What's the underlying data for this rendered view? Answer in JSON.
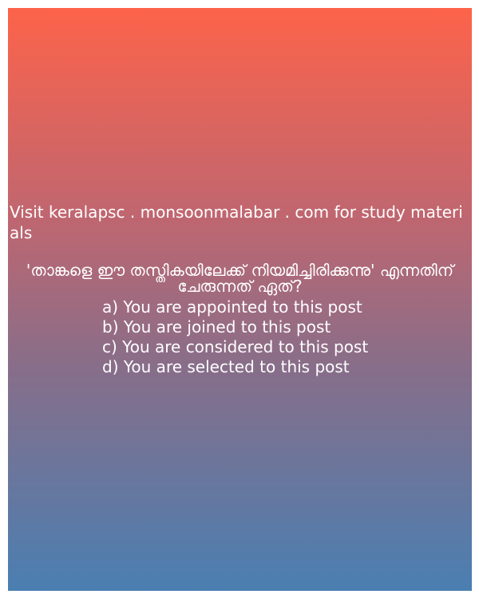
{
  "promo_text": "Visit keralapsc . monsoonmalabar . com for study materials",
  "question": "'താങ്കളെ ഈ തസ്തികയിലേക്ക് നിയമിച്ചിരിക്കുന്നു' എന്നതിന് ചേരുന്നത് ഏത്?",
  "options": [
    "a) You are appointed to this post",
    "b) You are joined to this post",
    "c) You are considered to this post",
    "d) You are selected to this post"
  ],
  "colors": {
    "gradient_top": "#fd634a",
    "gradient_bottom": "#4a7fb1",
    "text": "#ffffff"
  }
}
